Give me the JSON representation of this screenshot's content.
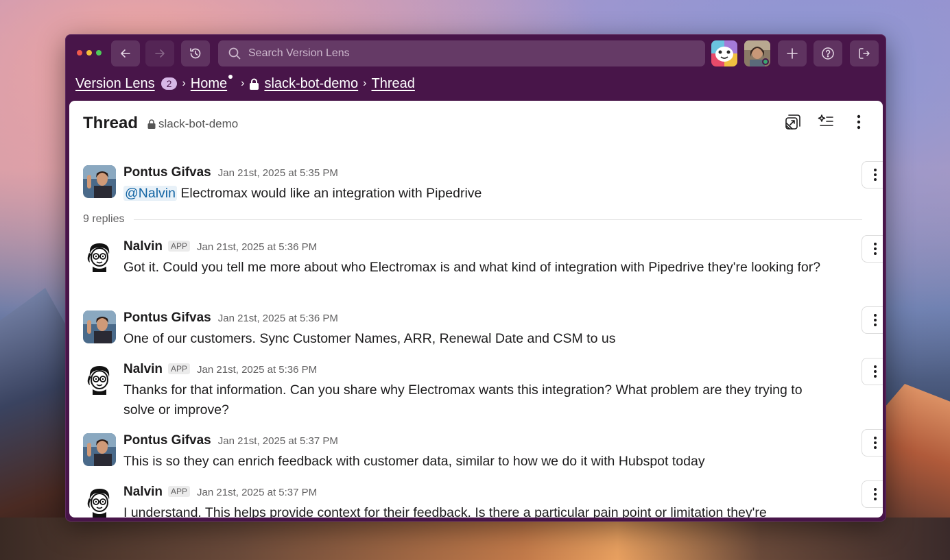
{
  "search": {
    "placeholder": "Search Version Lens"
  },
  "breadcrumb": {
    "workspace": "Version Lens",
    "workspace_badge": "2",
    "home": "Home",
    "channel": "slack-bot-demo",
    "current": "Thread"
  },
  "thread": {
    "title": "Thread",
    "channel": "slack-bot-demo",
    "replies_label": "9 replies"
  },
  "messages": [
    {
      "author": "Pontus Gifvas",
      "is_app": false,
      "time": "Jan 21st, 2025 at 5:35 PM",
      "mention": "@Nalvin",
      "text": "Electromax would like an integration with Pipedrive"
    },
    {
      "author": "Nalvin",
      "is_app": true,
      "app_badge": "APP",
      "time": "Jan 21st, 2025 at 5:36 PM",
      "text": "Got it. Could you tell me more about who Electromax is and what kind of integration with Pipedrive they're looking for?"
    },
    {
      "author": "Pontus Gifvas",
      "is_app": false,
      "time": "Jan 21st, 2025 at 5:36 PM",
      "text": "One of our customers. Sync Customer Names, ARR, Renewal Date and CSM to us"
    },
    {
      "author": "Nalvin",
      "is_app": true,
      "app_badge": "APP",
      "time": "Jan 21st, 2025 at 5:36 PM",
      "text": "Thanks for that information. Can you share why Electromax wants this integration? What problem are they trying to solve or improve?"
    },
    {
      "author": "Pontus Gifvas",
      "is_app": false,
      "time": "Jan 21st, 2025 at 5:37 PM",
      "text": "This is so they can enrich feedback with customer data, similar to how we do it with Hubspot today"
    },
    {
      "author": "Nalvin",
      "is_app": true,
      "app_badge": "APP",
      "time": "Jan 21st, 2025 at 5:37 PM",
      "text": "I understand. This helps provide context for their feedback. Is there a particular pain point or limitation they're"
    }
  ],
  "icons": {
    "traffic_lights": [
      "close-icon",
      "minimize-icon",
      "zoom-icon"
    ],
    "toolbar": [
      "back-arrow-icon",
      "forward-arrow-icon",
      "history-icon",
      "search-icon",
      "plus-icon",
      "help-icon",
      "sign-out-icon"
    ],
    "header": [
      "canvas-icon",
      "ai-summary-icon",
      "more-vertical-icon"
    ]
  },
  "colors": {
    "window_bg": "#481549",
    "mention": "#1264a3",
    "online": "#3aa770"
  }
}
